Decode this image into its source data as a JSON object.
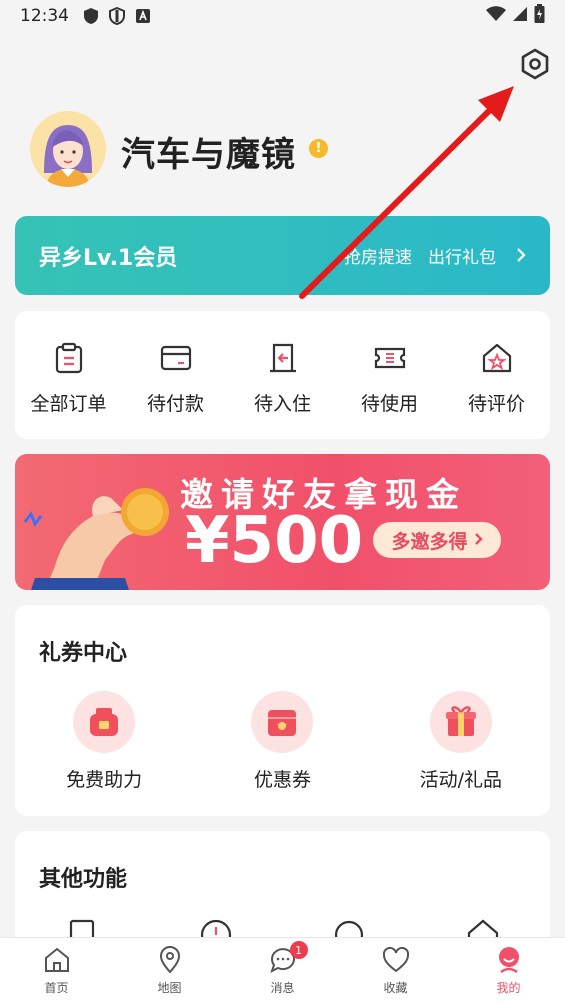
{
  "status_bar": {
    "time": "12:34"
  },
  "profile": {
    "username": "汽车与魔镜"
  },
  "member": {
    "title": "异乡Lv.1会员",
    "benefits": [
      "抢房提速",
      "出行礼包"
    ],
    "accent": "#36c3b5"
  },
  "orders": [
    {
      "label": "全部订单",
      "icon": "clipboard-icon"
    },
    {
      "label": "待付款",
      "icon": "card-icon"
    },
    {
      "label": "待入住",
      "icon": "door-icon"
    },
    {
      "label": "待使用",
      "icon": "ticket-icon"
    },
    {
      "label": "待评价",
      "icon": "house-star-icon"
    }
  ],
  "banner": {
    "title": "邀请好友拿现金",
    "amount": "¥500",
    "cta": "多邀多得"
  },
  "coupons": {
    "title": "礼券中心",
    "items": [
      {
        "label": "免费助力",
        "icon": "bag-icon"
      },
      {
        "label": "优惠券",
        "icon": "coupon-icon"
      },
      {
        "label": "活动/礼品",
        "icon": "gift-icon"
      }
    ]
  },
  "other": {
    "title": "其他功能"
  },
  "tabbar": {
    "items": [
      {
        "label": "首页",
        "icon": "home-icon"
      },
      {
        "label": "地图",
        "icon": "map-pin-icon"
      },
      {
        "label": "消息",
        "icon": "chat-icon",
        "badge": "1"
      },
      {
        "label": "收藏",
        "icon": "heart-icon"
      },
      {
        "label": "我的",
        "icon": "profile-icon",
        "active": true
      }
    ]
  },
  "colors": {
    "primary": "#f0506a",
    "teal": "#36c3b5",
    "background": "#f4f4f5"
  }
}
